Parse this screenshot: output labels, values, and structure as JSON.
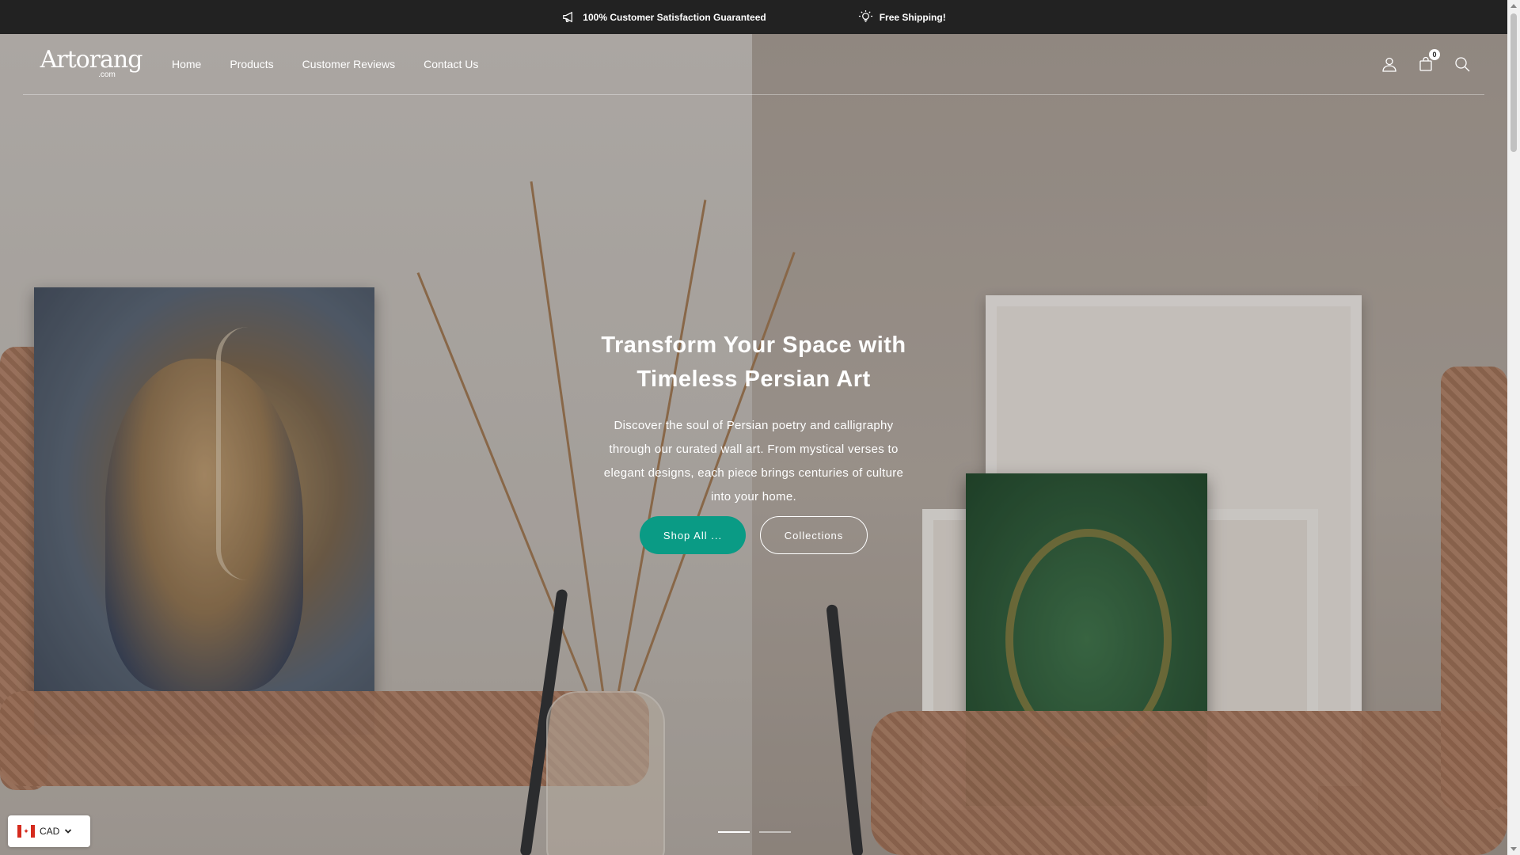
{
  "announcement": {
    "items": [
      {
        "icon": "megaphone-icon",
        "text": "100% Customer Satisfaction Guaranteed"
      },
      {
        "icon": "lightbulb-icon",
        "text": "Free Shipping!"
      }
    ]
  },
  "header": {
    "logo": {
      "name": "Artorang",
      "tld": ".com"
    },
    "nav": [
      "Home",
      "Products",
      "Customer Reviews",
      "Contact Us"
    ],
    "icons": [
      "account-icon",
      "cart-icon",
      "search-icon"
    ],
    "cart_count": "0"
  },
  "hero": {
    "title": "Transform Your Space with Timeless Persian Art",
    "description": "Discover the soul of Persian poetry and calligraphy through our curated wall art. From mystical verses to elegant designs, each piece brings centuries of culture into your home.",
    "primary_button": "Shop All ...",
    "secondary_button": "Collections",
    "slides": 2,
    "active_slide": 1,
    "accent_color": "#0a9b85"
  },
  "currency": {
    "code": "CAD",
    "flag": "canada-flag-icon"
  }
}
